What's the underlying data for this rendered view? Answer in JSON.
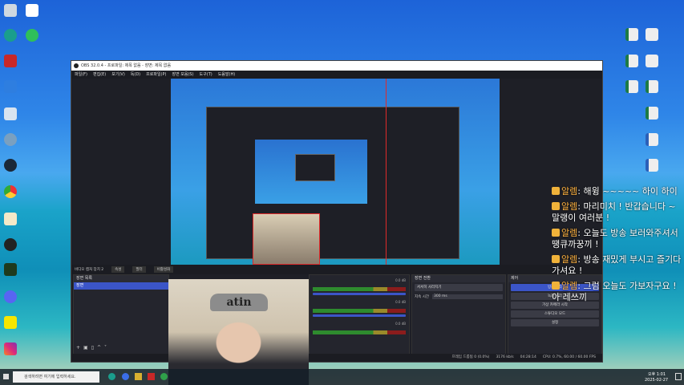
{
  "window": {
    "title": "OBS 32.0.4 - 프로파일: 제목 없음 - 장면: 제목 없음",
    "menu": [
      "파일(F)",
      "편집(E)",
      "보기(V)",
      "독(D)",
      "프로파일(P)",
      "장면 모음(S)",
      "도구(T)",
      "도움말(H)"
    ]
  },
  "scene_bar": {
    "source": "비디오 캡처 장치 2",
    "properties": "속성",
    "filters": "필터",
    "activate": "비활성화"
  },
  "scenes": {
    "header": "장면 목록",
    "items": [
      "장면"
    ]
  },
  "mixer": {
    "levels": [
      "0.0 dB",
      "0.0 dB",
      "0.0 dB"
    ]
  },
  "transitions": {
    "header": "장면 전환",
    "type": "서서히 사라지기",
    "duration_label": "지속 시간",
    "duration": "300 ms"
  },
  "controls": {
    "header": "제어",
    "buttons": [
      "방송 시작",
      "녹화 시작",
      "가상 카메라 시작",
      "스튜디오 모드",
      "설정"
    ]
  },
  "status": {
    "dropped": "프레임 드롭됨 0 (0.0%)",
    "bitrate": "3176 kb/s",
    "time": "04:28:14",
    "cpu": "CPU: 0.7%, 60.00 / 60.00 FPS"
  },
  "webcam": {
    "headband": "atin"
  },
  "chat": [
    {
      "nick": "알렘",
      "text": "해윙 ~~~~~ 하이 하이"
    },
    {
      "nick": "알렘",
      "text": "마리미치 ! 반갑습니다 ~ 말랭이 여러분 !"
    },
    {
      "nick": "알렘",
      "text": "오늘도 방송 보러와주셔서 땡큐까꿍끼 !"
    },
    {
      "nick": "알렘",
      "text": "방송 재밌게 부시고 즐기다 가셔요 !"
    },
    {
      "nick": "알렘",
      "text": "그럼 오늘도 가보자구요 ! 아 레쓰끼"
    }
  ],
  "taskbar": {
    "search": "검색하려면 여기에 입력하세요.",
    "time": "오후 1:01",
    "date": "2025-02-27"
  },
  "colors": {
    "accent": "#3b55c8",
    "nick": "#ffb23f"
  }
}
